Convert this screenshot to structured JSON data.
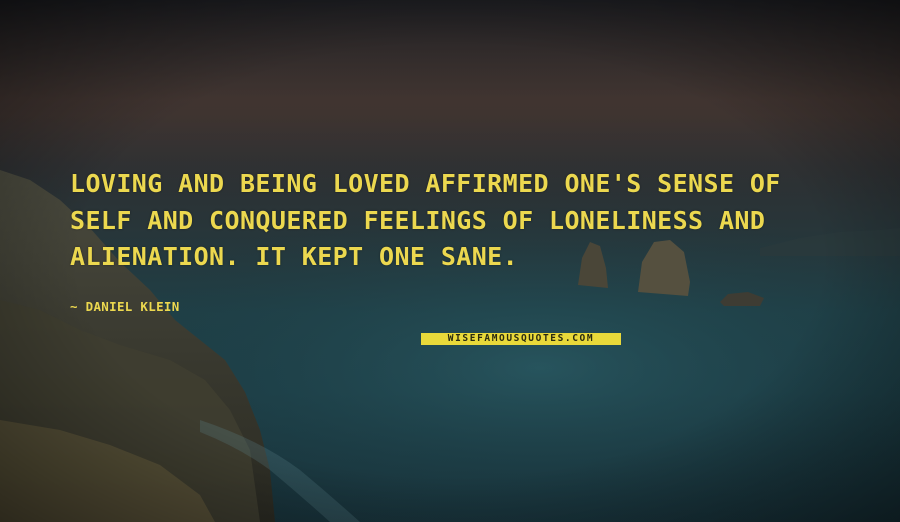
{
  "quote": {
    "text": "LOVING AND BEING LOVED AFFIRMED ONE'S SENSE OF SELF AND CONQUERED FEELINGS OF LONELINESS AND ALIENATION. IT KEPT ONE SANE.",
    "author": "~ DANIEL KLEIN"
  },
  "watermark": {
    "text": "WISEFAMOUSQUOTES.COM"
  },
  "colors": {
    "quote_text": "#ecd84f",
    "watermark_bg": "#e9d93a",
    "sea": "#1f3f46",
    "sky": "#2d2a2c"
  }
}
